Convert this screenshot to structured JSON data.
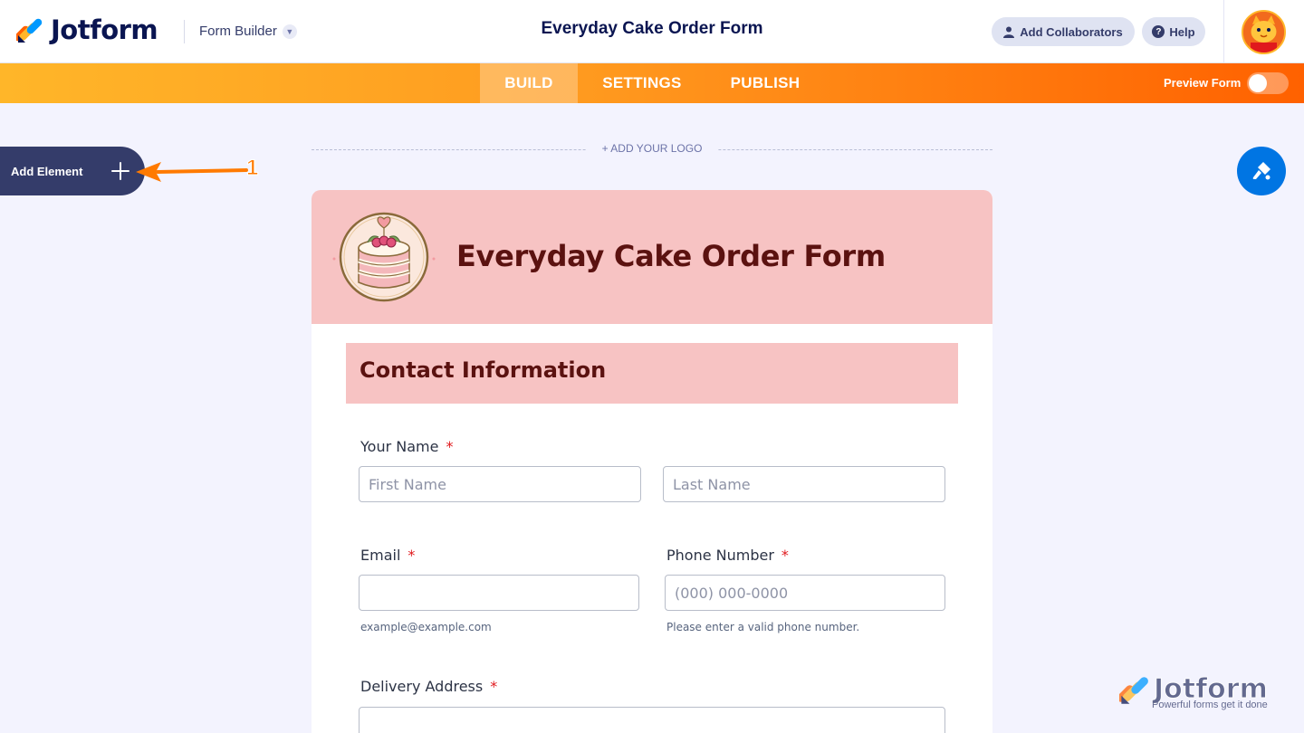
{
  "app": {
    "brand": "Jotform",
    "builder_menu": "Form Builder",
    "form_title": "Everyday Cake Order Form"
  },
  "header": {
    "collaborators_label": "Add Collaborators",
    "help_label": "Help"
  },
  "nav": {
    "tabs": [
      {
        "label": "BUILD",
        "active": true
      },
      {
        "label": "SETTINGS",
        "active": false
      },
      {
        "label": "PUBLISH",
        "active": false
      }
    ],
    "preview_label": "Preview Form",
    "preview_on": false
  },
  "sidebar": {
    "add_element_label": "Add Element",
    "annotation_number": "1"
  },
  "canvas": {
    "add_logo_label": "+ ADD YOUR LOGO"
  },
  "form": {
    "heading": "Everyday Cake Order Form",
    "section_title": "Contact Information",
    "fields": {
      "name": {
        "label": "Your Name",
        "required": "*",
        "first_placeholder": "First Name",
        "last_placeholder": "Last Name"
      },
      "email": {
        "label": "Email",
        "required": "*",
        "value": "",
        "sublabel": "example@example.com"
      },
      "phone": {
        "label": "Phone Number",
        "required": "*",
        "placeholder": "(000) 000-0000",
        "sublabel": "Please enter a valid phone number."
      },
      "address": {
        "label": "Delivery Address",
        "required": "*",
        "value": ""
      }
    }
  },
  "watermark": {
    "brand": "Jotform",
    "tagline": "Powerful forms get it done"
  },
  "colors": {
    "accent_orange": "#ff6100",
    "nav_start": "#ffb629",
    "header_pink": "#f7c3c3",
    "heading_maroon": "#5b1210",
    "navy": "#0a1551",
    "blue": "#0075e3"
  }
}
